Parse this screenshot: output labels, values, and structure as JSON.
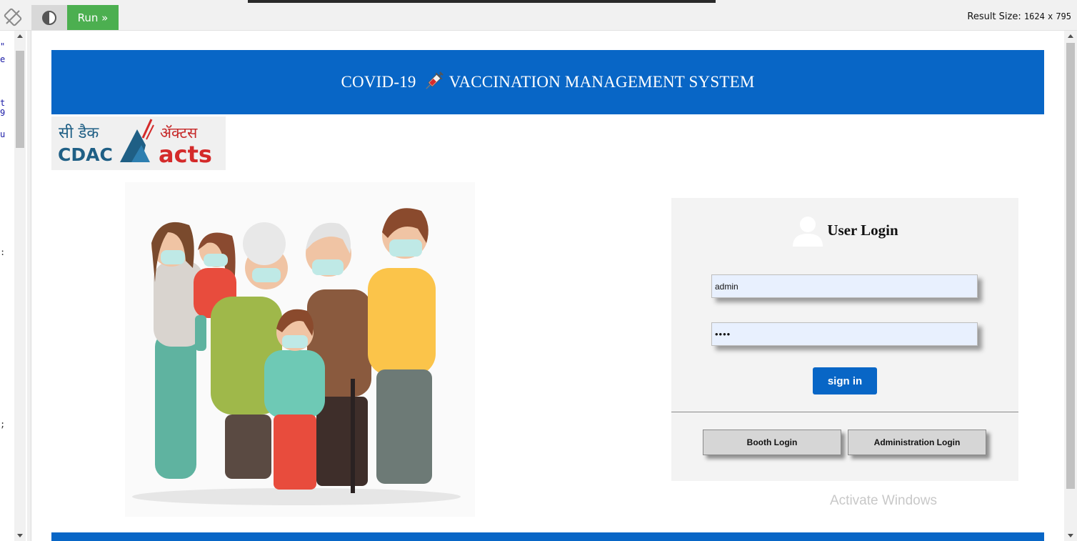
{
  "toolbar": {
    "run_label": "Run »",
    "result_size_label": "Result Size:",
    "result_width": "1624",
    "result_x": "x",
    "result_height": "795"
  },
  "code_fragments": [
    "\"",
    "e",
    "t",
    "9",
    "u",
    ":",
    ";"
  ],
  "header": {
    "title_left": "COVID-19",
    "title_right": "VACCINATION MANAGEMENT SYSTEM",
    "title_color": "#0866c6"
  },
  "logo": {
    "org_hindi": "सी डैक",
    "org_english": "CDAC",
    "acts_hindi": "ॲक्टस",
    "acts_english": "acts"
  },
  "login": {
    "title": "User Login",
    "username_value": "admin",
    "password_value": "••••",
    "signin_label": "sign in",
    "booth_login_label": "Booth Login",
    "admin_login_label": "Administration Login"
  },
  "watermark": "Activate Windows",
  "icons": {
    "rotate": "rotate-icon",
    "theme": "contrast-icon",
    "syringe": "syringe-icon",
    "user": "user-icon"
  }
}
